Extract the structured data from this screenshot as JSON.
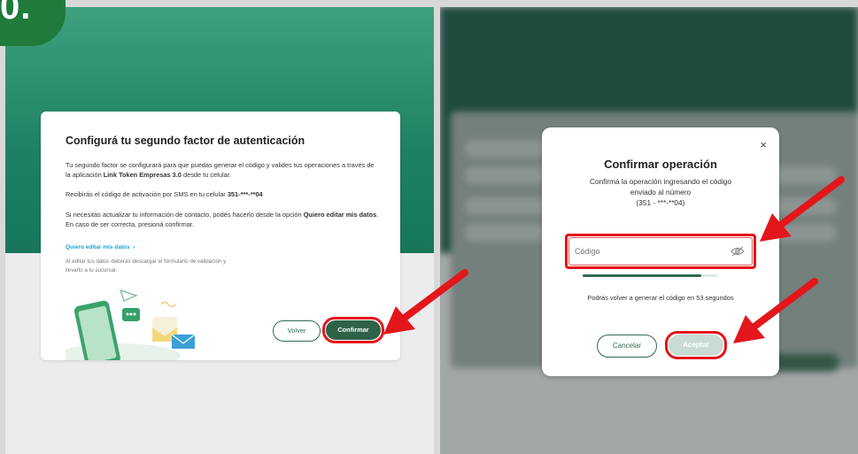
{
  "step_badge": "0.",
  "left_card": {
    "title": "Configurá tu segundo factor de autenticación",
    "p1_a": "Tu segundo factor se configurará para que puedas generar el código y valides tus operaciones a través de la aplicación ",
    "p1_app": "Link Token Empresas 3.0",
    "p1_b": " desde tu celular.",
    "p2_a": "Recibirás el código de activación por SMS en tu celular ",
    "p2_phone": "351-***-**04",
    "p3_a": "Si necesitás actualizar tu información de contacto, podés hacerlo desde la opción ",
    "p3_link": "Quiero editar mis datos",
    "p3_b": ". En caso de ser correcta, presioná confirmar.",
    "edit_link": "Quiero editar mis datos",
    "edit_chevron": "›",
    "edit_note": "Al editar tus datos deberás descargar el formulario de validación y llevarlo a tu sucursal.",
    "back_button": "Volver",
    "confirm_button": "Confirmar"
  },
  "modal": {
    "close": "×",
    "title": "Confirmar operación",
    "subtitle_line1": "Confirmá la operación ingresando el código",
    "subtitle_line2": "enviado al número",
    "subtitle_line3": "(351 - ***-**04)",
    "code_placeholder": "Código",
    "progress_fraction": 0.88,
    "regen_text": "Podrás volver a generar el código en 53 segundos",
    "cancel_button": "Cancelar",
    "accept_button": "Aceptar"
  },
  "colors": {
    "brand_green": "#2e6249",
    "highlight_red": "#e3161b",
    "link_blue": "#1aa3d6"
  },
  "icons": [
    "close-icon",
    "eye-off-icon",
    "chevron-right-icon",
    "red-arrow-icon"
  ]
}
